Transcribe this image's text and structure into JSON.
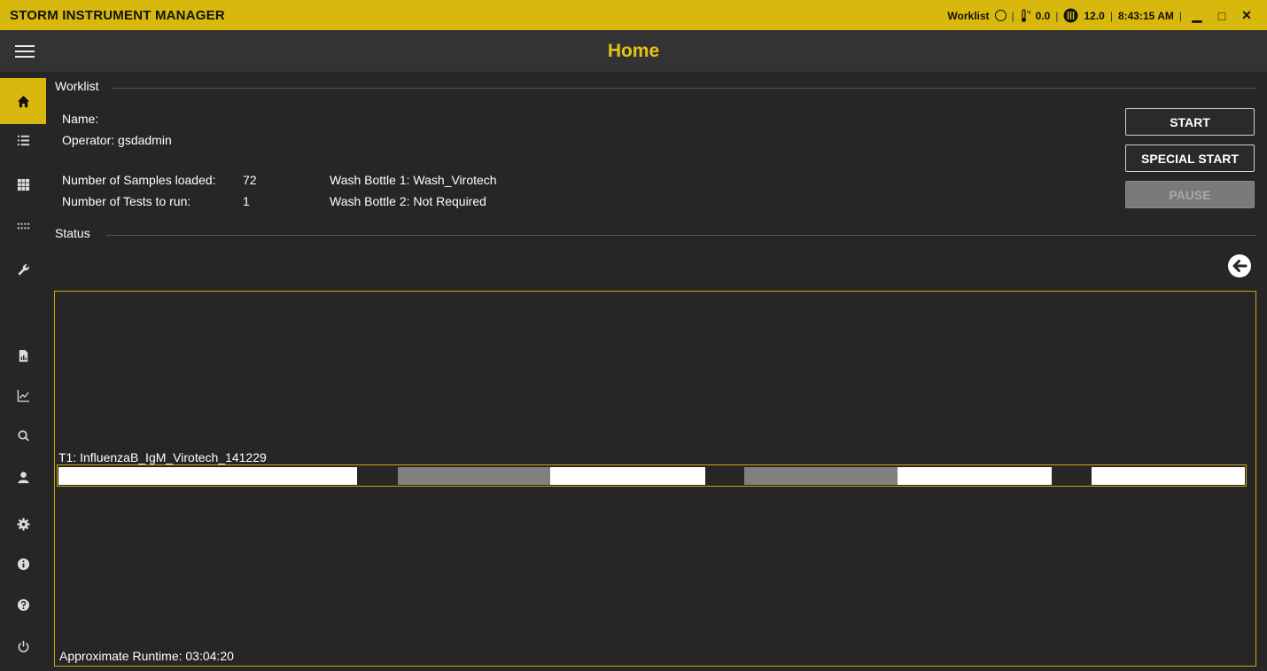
{
  "titlebar": {
    "app_title": "STORM INSTRUMENT MANAGER",
    "worklist_label": "Worklist",
    "temperature": "0.0",
    "heater_value": "12.0",
    "time": "8:43:15 AM",
    "minimize": "▁",
    "maximize": "□",
    "close": "✕"
  },
  "header": {
    "title": "Home"
  },
  "sidebar": {
    "items": [
      {
        "name": "home-icon",
        "active": true
      },
      {
        "name": "list-icon"
      },
      {
        "name": "plate-grid-icon"
      },
      {
        "name": "dots-grid-icon"
      },
      {
        "name": "wrench-icon"
      },
      {
        "name": "report-icon"
      },
      {
        "name": "chart-icon"
      },
      {
        "name": "search-icon"
      },
      {
        "name": "user-icon"
      },
      {
        "name": "gear-icon"
      },
      {
        "name": "info-icon"
      },
      {
        "name": "help-icon"
      },
      {
        "name": "power-icon"
      }
    ]
  },
  "worklist": {
    "section_label": "Worklist",
    "name_label": "Name:",
    "name_value": "",
    "operator_label": "Operator:",
    "operator_value": "gsdadmin",
    "samples_label": "Number of Samples loaded:",
    "samples_value": "72",
    "tests_label": "Number of Tests to run:",
    "tests_value": "1",
    "wash1_label": "Wash Bottle 1:",
    "wash1_value": "Wash_Virotech",
    "wash2_label": "Wash Bottle 2:",
    "wash2_value": "Not Required"
  },
  "actions": {
    "start": "START",
    "special_start": "SPECIAL START",
    "pause": "PAUSE"
  },
  "status": {
    "section_label": "Status",
    "test_label": "T1: InfluenzaB_IgM_Virotech_141229",
    "runtime": "Approximate Runtime: 03:04:20"
  },
  "colors": {
    "accent": "#d8b80c",
    "background": "#262626",
    "header": "#333333",
    "segment_white": "#ffffff",
    "segment_gray": "#808080"
  }
}
